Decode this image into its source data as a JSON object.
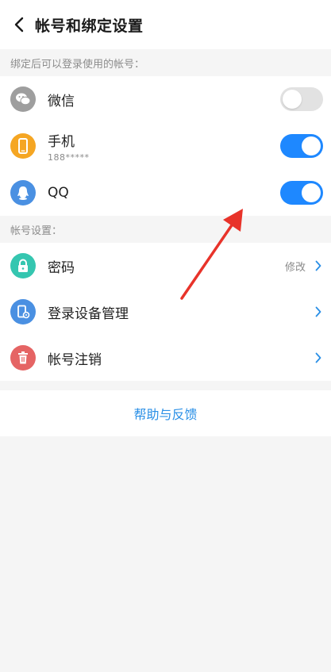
{
  "header": {
    "title": "帐号和绑定设置"
  },
  "bind_section": {
    "label": "绑定后可以登录使用的帐号：",
    "items": [
      {
        "label": "微信",
        "sub": "",
        "enabled": false,
        "icon": "wechat-icon",
        "color": "#9e9e9e"
      },
      {
        "label": "手机",
        "sub": "188*****",
        "enabled": true,
        "icon": "phone-icon",
        "color": "#f5a623"
      },
      {
        "label": "QQ",
        "sub": "",
        "enabled": true,
        "icon": "qq-icon",
        "color": "#4a90e2"
      }
    ]
  },
  "account_section": {
    "label": "帐号设置：",
    "items": [
      {
        "label": "密码",
        "hint": "修改",
        "icon": "lock-icon",
        "color": "#35c6b0"
      },
      {
        "label": "登录设备管理",
        "hint": "",
        "icon": "device-icon",
        "color": "#4a90e2"
      },
      {
        "label": "帐号注销",
        "hint": "",
        "icon": "trash-icon",
        "color": "#e56464"
      }
    ]
  },
  "help": {
    "label": "帮助与反馈"
  },
  "colors": {
    "accent": "#1e88ff",
    "link": "#2a8fe6",
    "annotation": "#e8332a"
  }
}
